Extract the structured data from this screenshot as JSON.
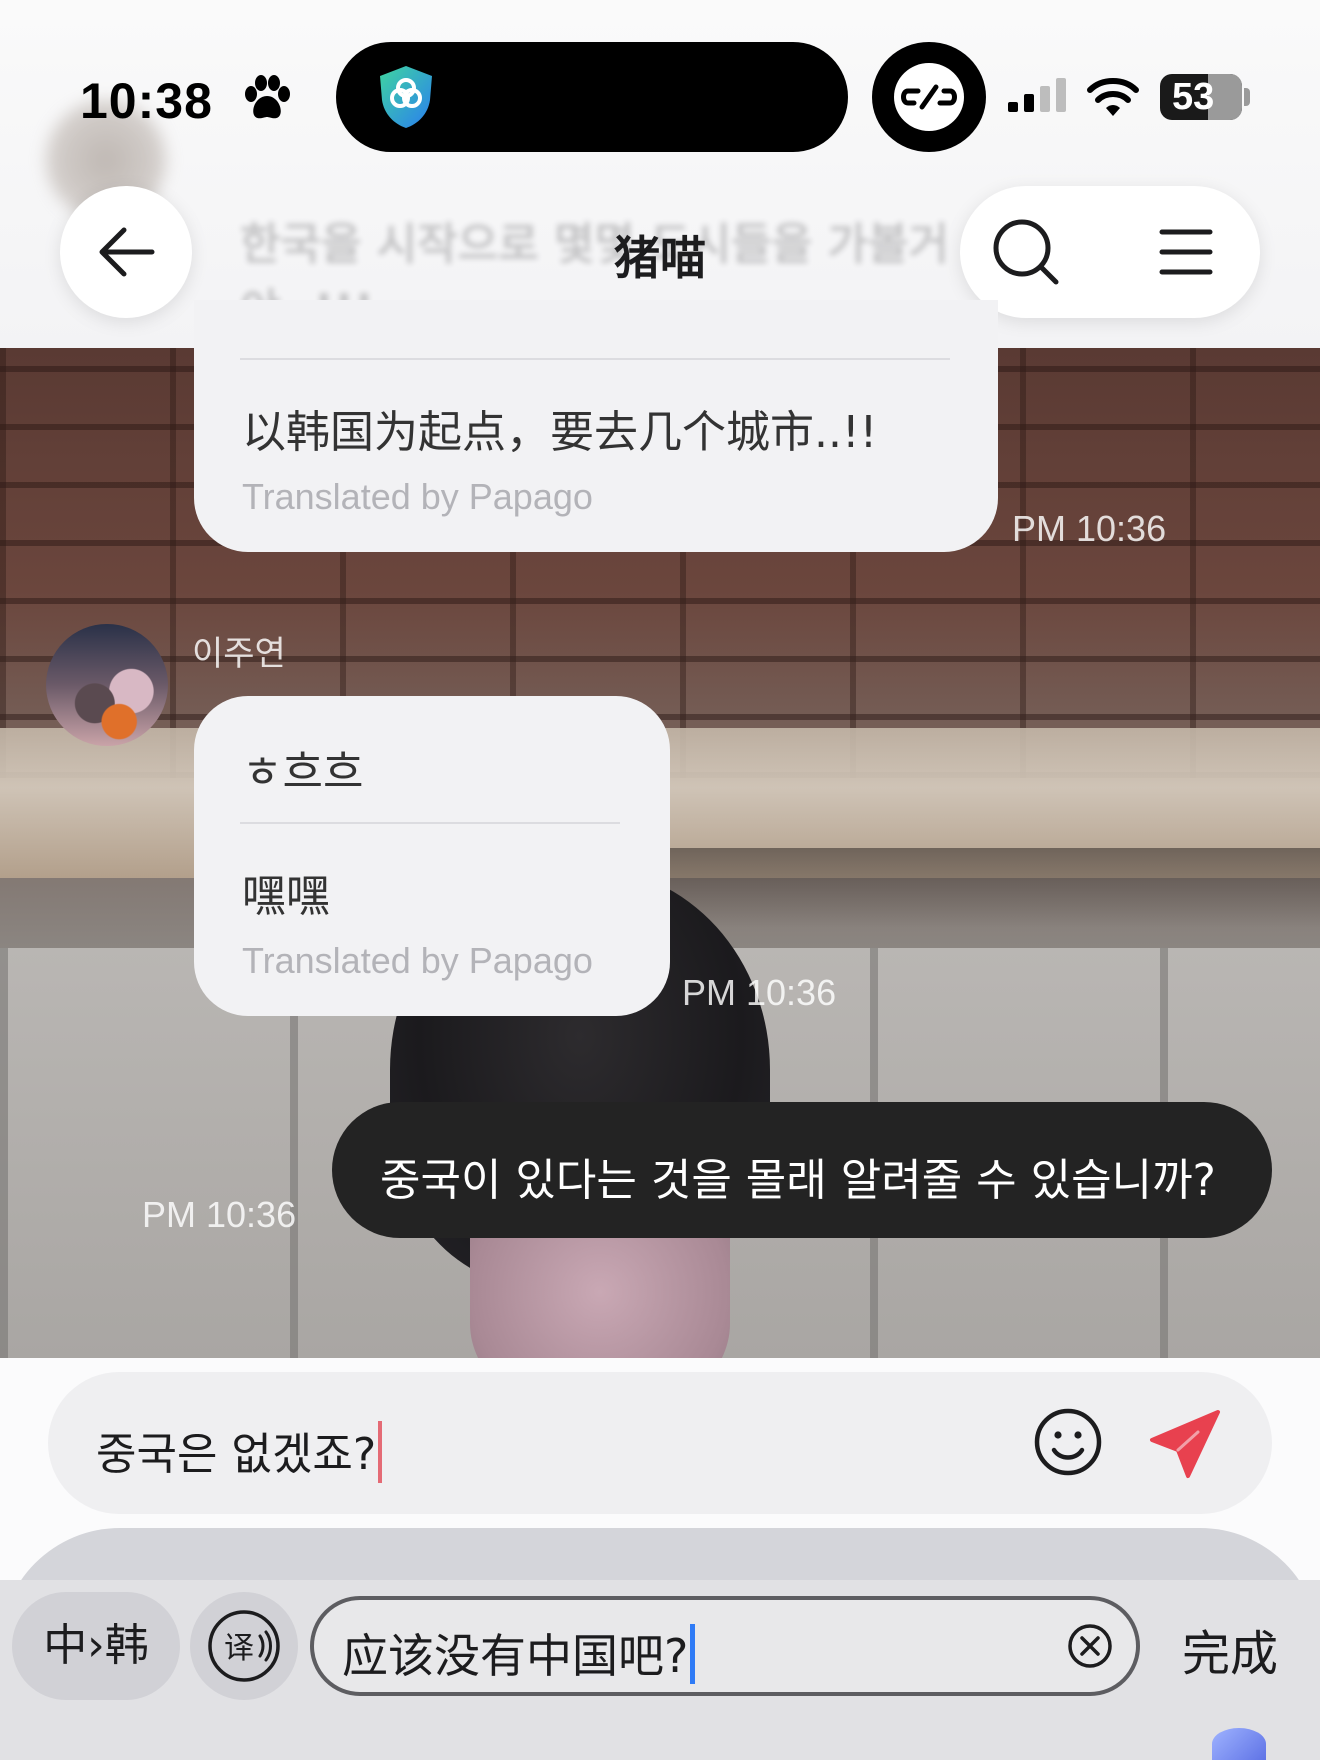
{
  "status_bar": {
    "time": "10:38",
    "battery": "53",
    "icons": [
      "paw-icon",
      "vpn-shield-icon",
      "link-icon",
      "cellular-signal-icon",
      "wifi-icon",
      "battery-icon"
    ]
  },
  "header": {
    "title": "猪喵",
    "faded_previous_text": "한국을 시작으로 몇몇 도시들을 가볼거야..!!!",
    "back_icon": "arrow-left-icon",
    "search_icon": "search-icon",
    "menu_icon": "menu-icon"
  },
  "messages": [
    {
      "translation": "以韩国为起点，要去几个城市..!!",
      "translated_by": "Translated by Papago",
      "time": "PM 10:36"
    },
    {
      "sender": "이주연",
      "original": "ㅎ흐흐",
      "translation": "嘿嘿",
      "translated_by": "Translated by Papago",
      "time": "PM 10:36"
    },
    {
      "text": "중국이 있다는 것을 몰래 알려줄 수 있습니까?",
      "time": "PM 10:36"
    }
  ],
  "composer": {
    "value": "중국은 없겠죠?",
    "emoji_icon": "smiley-icon",
    "send_icon": "send-icon"
  },
  "translate_bar": {
    "language_pair": "中›韩",
    "translate_icon": "translate-icon",
    "input_value": "应该没有中国吧?",
    "clear_icon": "clear-circle-icon",
    "done_label": "完成"
  },
  "colors": {
    "accent_send": "#e8414f",
    "caret_blue": "#2f7bf6",
    "outgoing_bubble": "#232323",
    "incoming_bubble": "#f2f2f4"
  }
}
